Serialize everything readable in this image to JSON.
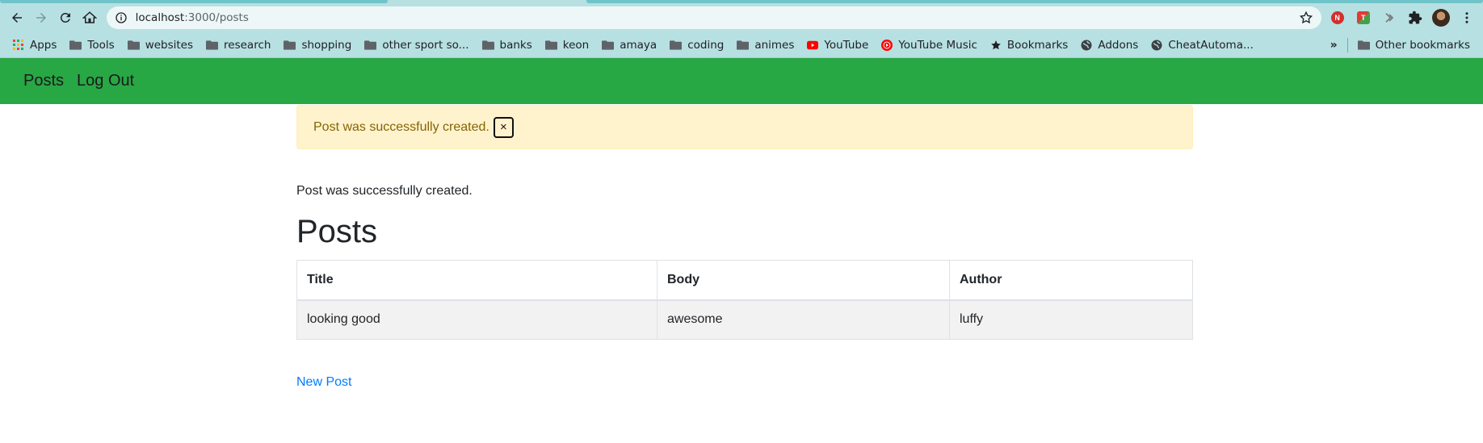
{
  "browser": {
    "url_host": "localhost",
    "url_path": ":3000/posts",
    "bookmarks": [
      {
        "label": "Apps",
        "icon": "apps-grid-icon"
      },
      {
        "label": "Tools",
        "icon": "folder-icon"
      },
      {
        "label": "websites",
        "icon": "folder-icon"
      },
      {
        "label": "research",
        "icon": "folder-icon"
      },
      {
        "label": "shopping",
        "icon": "folder-icon"
      },
      {
        "label": "other sport so...",
        "icon": "folder-icon"
      },
      {
        "label": "banks",
        "icon": "folder-icon"
      },
      {
        "label": "keon",
        "icon": "folder-icon"
      },
      {
        "label": "amaya",
        "icon": "folder-icon"
      },
      {
        "label": "coding",
        "icon": "folder-icon"
      },
      {
        "label": "animes",
        "icon": "folder-icon"
      },
      {
        "label": "YouTube",
        "icon": "youtube-icon"
      },
      {
        "label": "YouTube Music",
        "icon": "youtube-music-icon"
      },
      {
        "label": "Bookmarks",
        "icon": "star-icon"
      },
      {
        "label": "Addons",
        "icon": "globe-icon"
      },
      {
        "label": "CheatAutoma...",
        "icon": "globe-icon"
      }
    ],
    "overflow_label": "»",
    "other_bookmarks": "Other bookmarks"
  },
  "nav": {
    "posts": "Posts",
    "logout": "Log Out"
  },
  "alert": {
    "message": "Post was successfully created.",
    "close": "×"
  },
  "notice": "Post was successfully created.",
  "page_title": "Posts",
  "table": {
    "headers": [
      "Title",
      "Body",
      "Author"
    ],
    "rows": [
      [
        "looking good",
        "awesome",
        "luffy"
      ]
    ]
  },
  "new_post_link": "New Post",
  "colors": {
    "navbar": "#28a745",
    "alert_bg": "#fff3cd",
    "alert_text": "#856404",
    "link": "#007bff",
    "chrome": "#b7e0e2"
  }
}
